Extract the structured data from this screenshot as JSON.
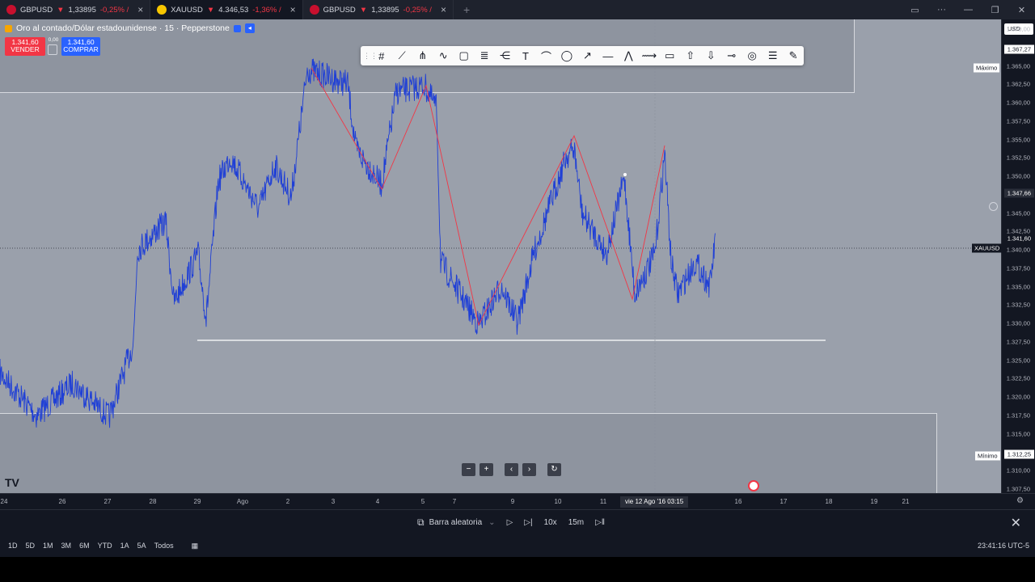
{
  "tabs": [
    {
      "symbol": "GBPUSD",
      "arrow": "▼",
      "price": "1,33895",
      "change": "-0,25% /",
      "active": false,
      "logo_color": "#c8102e"
    },
    {
      "symbol": "XAUUSD",
      "arrow": "▼",
      "price": "4.346,53",
      "change": "-1,36% /",
      "active": true,
      "logo_color": "#f7c600"
    },
    {
      "symbol": "GBPUSD",
      "arrow": "▼",
      "price": "1,33895",
      "change": "-0,25% /",
      "active": false,
      "logo_color": "#c8102e"
    }
  ],
  "legend": {
    "title": "Oro al contado/Dólar estadounidense · 15 · Pepperstone"
  },
  "trade": {
    "sell_price": "1.341,60",
    "sell_label": "VENDER",
    "spread": "0,00",
    "buy_price": "1.341,60",
    "buy_label": "COMPRAR"
  },
  "price_axis": {
    "currency": "USD",
    "ticks": [
      "1.370,00",
      "1.365,00",
      "1.362,50",
      "1.360,00",
      "1.357,50",
      "1.355,00",
      "1.352,50",
      "1.350,00",
      "1.345,00",
      "1.342,50",
      "1.340,00",
      "1.337,50",
      "1.335,00",
      "1.332,50",
      "1.330,00",
      "1.327,50",
      "1.325,00",
      "1.322,50",
      "1.320,00",
      "1.317,50",
      "1.315,00",
      "1.310,00",
      "1.307,50"
    ],
    "max_label": "Máximo",
    "max_value": "1.367,27",
    "crosshair_value": "1.347,66",
    "symbol_tag": "XAUUSD",
    "last_value": "1.341,60",
    "min_label": "Mínimo",
    "min_value": "1.312,25"
  },
  "time_axis": {
    "ticks": [
      "24",
      "26",
      "27",
      "28",
      "29",
      "Ago",
      "2",
      "3",
      "4",
      "5",
      "7",
      "9",
      "10",
      "11",
      "12",
      "16",
      "17",
      "18",
      "19",
      "21"
    ],
    "crosshair": "vie 12 Ago '16   03:15"
  },
  "replay": {
    "label": "Barra aleatoria",
    "speed": "10x",
    "interval": "15m"
  },
  "ranges": [
    "1D",
    "5D",
    "1M",
    "3M",
    "6M",
    "YTD",
    "1A",
    "5A",
    "Todos"
  ],
  "clock": "23:41:16 UTC-5",
  "colors": {
    "price_line": "#1f3fd6",
    "zigzag": "#f23645",
    "sell": "#f23645",
    "buy": "#2962ff"
  },
  "icons": [
    "grid-icon",
    "trend-line-icon",
    "pitchfork-icon",
    "wave-icon",
    "rectangle-icon",
    "fib-icon",
    "channel-icon",
    "text-icon",
    "brush-icon",
    "ellipse-icon",
    "arrow-icon",
    "horizontal-line-icon",
    "pattern-icon",
    "path-icon",
    "note-icon",
    "arrow-up-icon",
    "arrow-down-icon",
    "ray-icon",
    "target-icon",
    "menu-icon",
    "pen-icon"
  ]
}
